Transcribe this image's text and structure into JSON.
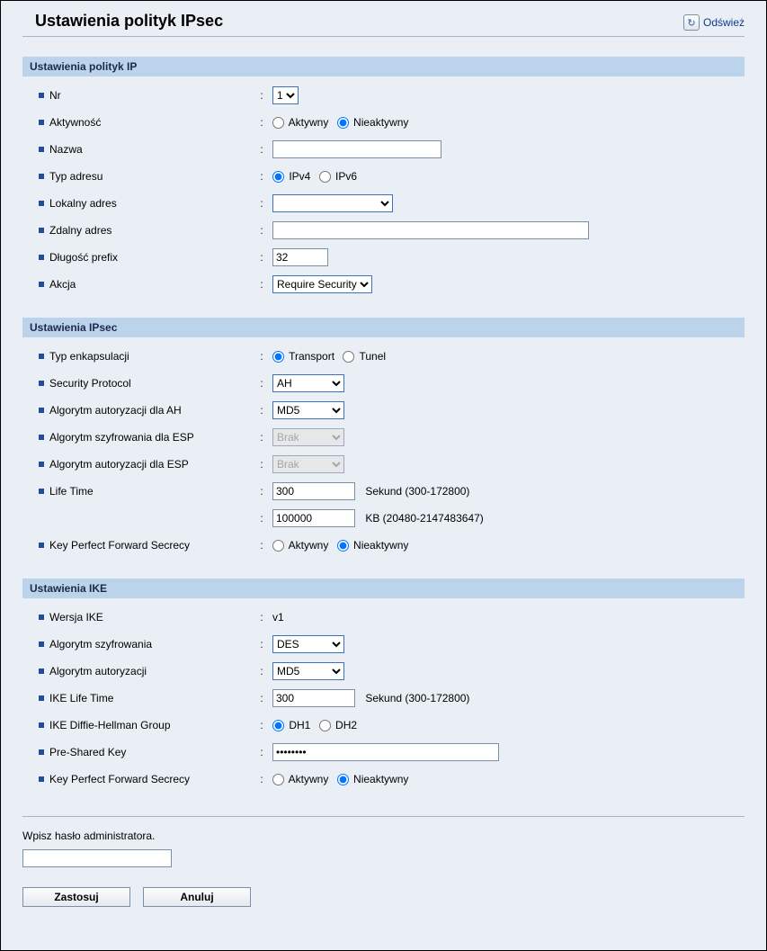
{
  "header": {
    "title": "Ustawienia polityk IPsec",
    "refresh_label": "Odśwież"
  },
  "sections": {
    "ip": {
      "bar": "Ustawienia polityk IP"
    },
    "ipsec": {
      "bar": "Ustawienia IPsec"
    },
    "ike": {
      "bar": "Ustawienia IKE"
    }
  },
  "ip": {
    "nr_label": "Nr",
    "nr_options": [
      "1"
    ],
    "activity_label": "Aktywność",
    "active_label": "Aktywny",
    "inactive_label": "Nieaktywny",
    "name_label": "Nazwa",
    "name_value": "",
    "addr_type_label": "Typ adresu",
    "ipv4_label": "IPv4",
    "ipv6_label": "IPv6",
    "local_addr_label": "Lokalny adres",
    "local_addr_value": "",
    "remote_addr_label": "Zdalny adres",
    "remote_addr_value": "",
    "prefix_label": "Długość prefix",
    "prefix_value": "32",
    "action_label": "Akcja",
    "action_options": [
      "Require Security"
    ]
  },
  "ipsec": {
    "encap_label": "Typ enkapsulacji",
    "transport_label": "Transport",
    "tunnel_label": "Tunel",
    "secproto_label": "Security Protocol",
    "secproto_options": [
      "AH"
    ],
    "ah_auth_label": "Algorytm autoryzacji dla AH",
    "ah_auth_options": [
      "MD5"
    ],
    "esp_enc_label": "Algorytm szyfrowania dla ESP",
    "esp_enc_options": [
      "Brak"
    ],
    "esp_auth_label": "Algorytm autoryzacji dla ESP",
    "esp_auth_options": [
      "Brak"
    ],
    "life_label": "Life Time",
    "life_sec_value": "300",
    "life_sec_hint": "Sekund (300-172800)",
    "life_kb_value": "100000",
    "life_kb_hint": "KB (20480-2147483647)",
    "pfs_label": "Key Perfect Forward Secrecy",
    "active_label": "Aktywny",
    "inactive_label": "Nieaktywny"
  },
  "ike": {
    "version_label": "Wersja IKE",
    "version_value": "v1",
    "enc_label": "Algorytm szyfrowania",
    "enc_options": [
      "DES"
    ],
    "auth_label": "Algorytm autoryzacji",
    "auth_options": [
      "MD5"
    ],
    "life_label": "IKE Life Time",
    "life_value": "300",
    "life_hint": "Sekund (300-172800)",
    "dh_label": "IKE Diffie-Hellman Group",
    "dh1_label": "DH1",
    "dh2_label": "DH2",
    "psk_label": "Pre-Shared Key",
    "psk_value": "••••••••",
    "pfs_label": "Key Perfect Forward Secrecy",
    "active_label": "Aktywny",
    "inactive_label": "Nieaktywny"
  },
  "footer": {
    "prompt": "Wpisz hasło administratora.",
    "admin_pw_value": "",
    "apply_label": "Zastosuj",
    "cancel_label": "Anuluj"
  }
}
